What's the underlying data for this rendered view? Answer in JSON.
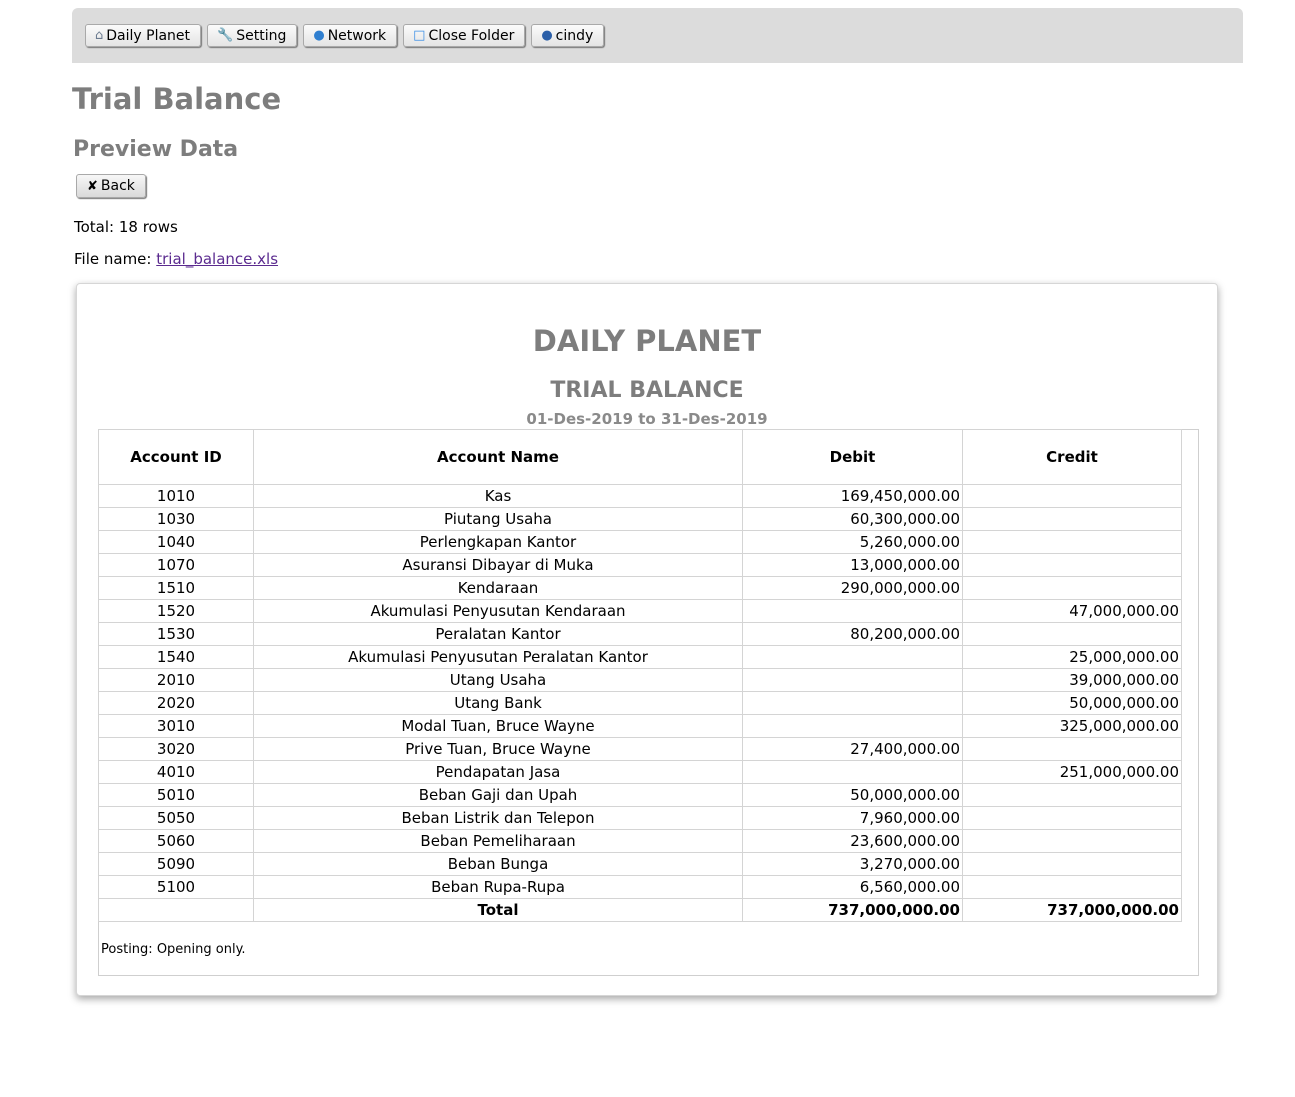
{
  "nav": {
    "buttons": [
      {
        "label": "Daily Planet",
        "icon": "home-icon"
      },
      {
        "label": "Setting",
        "icon": "wrench-icon"
      },
      {
        "label": "Network",
        "icon": "globe-icon"
      },
      {
        "label": "Close Folder",
        "icon": "folder-icon"
      },
      {
        "label": "cindy",
        "icon": "user-icon"
      }
    ]
  },
  "page": {
    "title": "Trial Balance",
    "subtitle": "Preview Data",
    "back_label": "Back",
    "total_label": "Total: 18 rows",
    "file_prefix": "File name:",
    "file_name": "trial_balance.xls"
  },
  "report": {
    "company": "DAILY PLANET",
    "title": "TRIAL BALANCE",
    "period": "01-Des-2019 to 31-Des-2019",
    "columns": [
      "Account ID",
      "Account Name",
      "Debit",
      "Credit"
    ],
    "rows": [
      {
        "id": "1010",
        "name": "Kas",
        "debit": "169,450,000.00",
        "credit": ""
      },
      {
        "id": "1030",
        "name": "Piutang Usaha",
        "debit": "60,300,000.00",
        "credit": ""
      },
      {
        "id": "1040",
        "name": "Perlengkapan Kantor",
        "debit": "5,260,000.00",
        "credit": ""
      },
      {
        "id": "1070",
        "name": "Asuransi Dibayar di Muka",
        "debit": "13,000,000.00",
        "credit": ""
      },
      {
        "id": "1510",
        "name": "Kendaraan",
        "debit": "290,000,000.00",
        "credit": ""
      },
      {
        "id": "1520",
        "name": "Akumulasi Penyusutan Kendaraan",
        "debit": "",
        "credit": "47,000,000.00"
      },
      {
        "id": "1530",
        "name": "Peralatan Kantor",
        "debit": "80,200,000.00",
        "credit": ""
      },
      {
        "id": "1540",
        "name": "Akumulasi Penyusutan Peralatan Kantor",
        "debit": "",
        "credit": "25,000,000.00"
      },
      {
        "id": "2010",
        "name": "Utang Usaha",
        "debit": "",
        "credit": "39,000,000.00"
      },
      {
        "id": "2020",
        "name": "Utang Bank",
        "debit": "",
        "credit": "50,000,000.00"
      },
      {
        "id": "3010",
        "name": "Modal Tuan, Bruce Wayne",
        "debit": "",
        "credit": "325,000,000.00"
      },
      {
        "id": "3020",
        "name": "Prive Tuan, Bruce Wayne",
        "debit": "27,400,000.00",
        "credit": ""
      },
      {
        "id": "4010",
        "name": "Pendapatan Jasa",
        "debit": "",
        "credit": "251,000,000.00"
      },
      {
        "id": "5010",
        "name": "Beban Gaji dan Upah",
        "debit": "50,000,000.00",
        "credit": ""
      },
      {
        "id": "5050",
        "name": "Beban Listrik dan Telepon",
        "debit": "7,960,000.00",
        "credit": ""
      },
      {
        "id": "5060",
        "name": "Beban Pemeliharaan",
        "debit": "23,600,000.00",
        "credit": ""
      },
      {
        "id": "5090",
        "name": "Beban Bunga",
        "debit": "3,270,000.00",
        "credit": ""
      },
      {
        "id": "5100",
        "name": "Beban Rupa-Rupa",
        "debit": "6,560,000.00",
        "credit": ""
      }
    ],
    "total": {
      "label": "Total",
      "debit": "737,000,000.00",
      "credit": "737,000,000.00"
    },
    "posting_note": "Posting: Opening only."
  }
}
